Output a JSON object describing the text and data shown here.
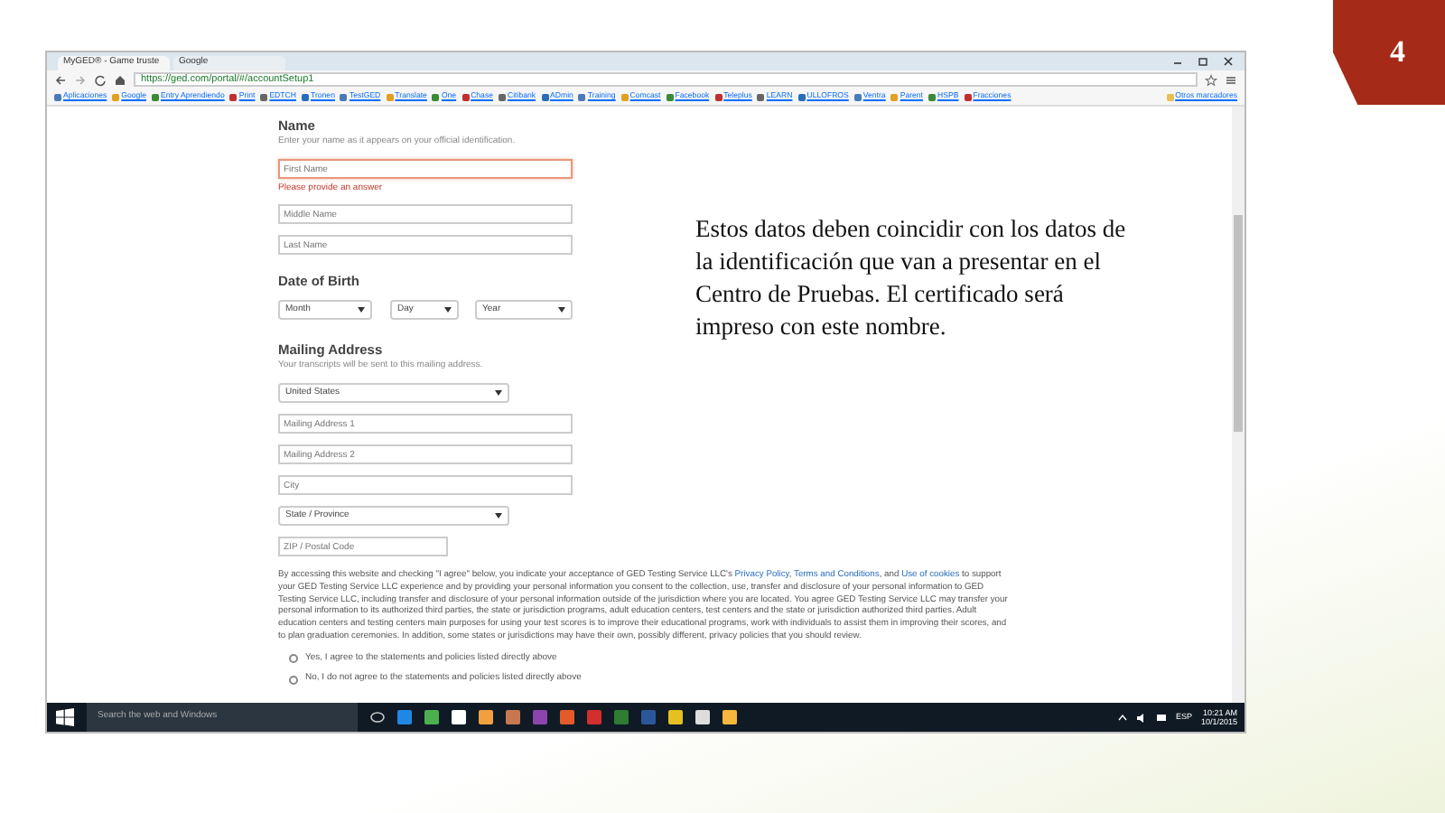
{
  "slide": {
    "number": "4",
    "note": "Estos datos deben coincidir con los datos de la identificación que van a presentar en el Centro de Pruebas. El certificado será impreso con este nombre."
  },
  "browser": {
    "tabs": [
      {
        "title": "MyGED® - Game truste",
        "selected": true
      },
      {
        "title": "Google",
        "selected": false
      }
    ],
    "url": "https://ged.com/portal/#/accountSetup1",
    "bookmarks": [
      "Aplicaciones",
      "Google",
      "Entry Aprendiendo",
      "Print",
      "EDTCH",
      "Tronen",
      "TestGED",
      "Translate",
      "One",
      "Chase",
      "Citibank",
      "ADmin",
      "Training",
      "Comcast",
      "Facebook",
      "Teleplus",
      "LEARN",
      "ULLOFROS",
      "Ventra",
      "Parent",
      "HSPB",
      "Fracciones"
    ],
    "bookmarks_more": "Otros marcadores"
  },
  "form": {
    "name": {
      "heading": "Name",
      "hint": "Enter your name as it appears on your official identification.",
      "fields": [
        {
          "placeholder": "First Name",
          "invalid": true,
          "error": "Please provide an answer"
        },
        {
          "placeholder": "Middle Name",
          "invalid": false
        },
        {
          "placeholder": "Last Name",
          "invalid": false
        }
      ]
    },
    "birth": {
      "heading": "Date of Birth",
      "selects": [
        "Month",
        "Day",
        "Year"
      ]
    },
    "address": {
      "heading": "Mailing Address",
      "hint": "Your transcripts will be sent to this mailing address.",
      "fields": [
        {
          "kind": "select",
          "value": "United States"
        },
        {
          "kind": "input",
          "placeholder": "Mailing Address 1"
        },
        {
          "kind": "input",
          "placeholder": "Mailing Address 2"
        },
        {
          "kind": "input",
          "placeholder": "City"
        },
        {
          "kind": "select",
          "value": "State / Province"
        },
        {
          "kind": "input",
          "placeholder": "ZIP / Postal Code"
        }
      ]
    },
    "consent": {
      "parts": [
        {
          "kind": "text",
          "text": "By accessing this website and checking \"I agree\" below, you indicate your acceptance of GED Testing Service LLC's "
        },
        {
          "kind": "link",
          "text": "Privacy Policy"
        },
        {
          "kind": "text",
          "text": ", "
        },
        {
          "kind": "link",
          "text": "Terms and Conditions"
        },
        {
          "kind": "text",
          "text": ", and "
        },
        {
          "kind": "link",
          "text": "Use of cookies"
        },
        {
          "kind": "text",
          "text": " to support your GED Testing Service LLC experience and by providing your personal information you consent to the collection, use, transfer and disclosure of your personal information to GED Testing Service LLC, including transfer and disclosure of your personal information outside of the jurisdiction where you are located. You agree GED Testing Service LLC may transfer your personal information to its authorized third parties, the state or jurisdiction programs, adult education centers, test centers and the state or jurisdiction authorized third parties. Adult education centers and testing centers main purposes for using your test scores is to improve their educational programs, work with individuals to assist them in improving their scores, and to plan graduation ceremonies. In addition, some states or jurisdictions may have their own, possibly different, privacy policies that you should review."
        }
      ],
      "options": [
        {
          "label": "Yes, I agree to the statements and policies listed directly above",
          "selected": false
        },
        {
          "label": "No, I do not agree to the statements and policies listed directly above",
          "selected": false
        }
      ]
    }
  },
  "taskbar": {
    "search_placeholder": "Search the web and Windows",
    "language": "ESP",
    "time": "10:21 AM",
    "date": "10/1/2015"
  }
}
